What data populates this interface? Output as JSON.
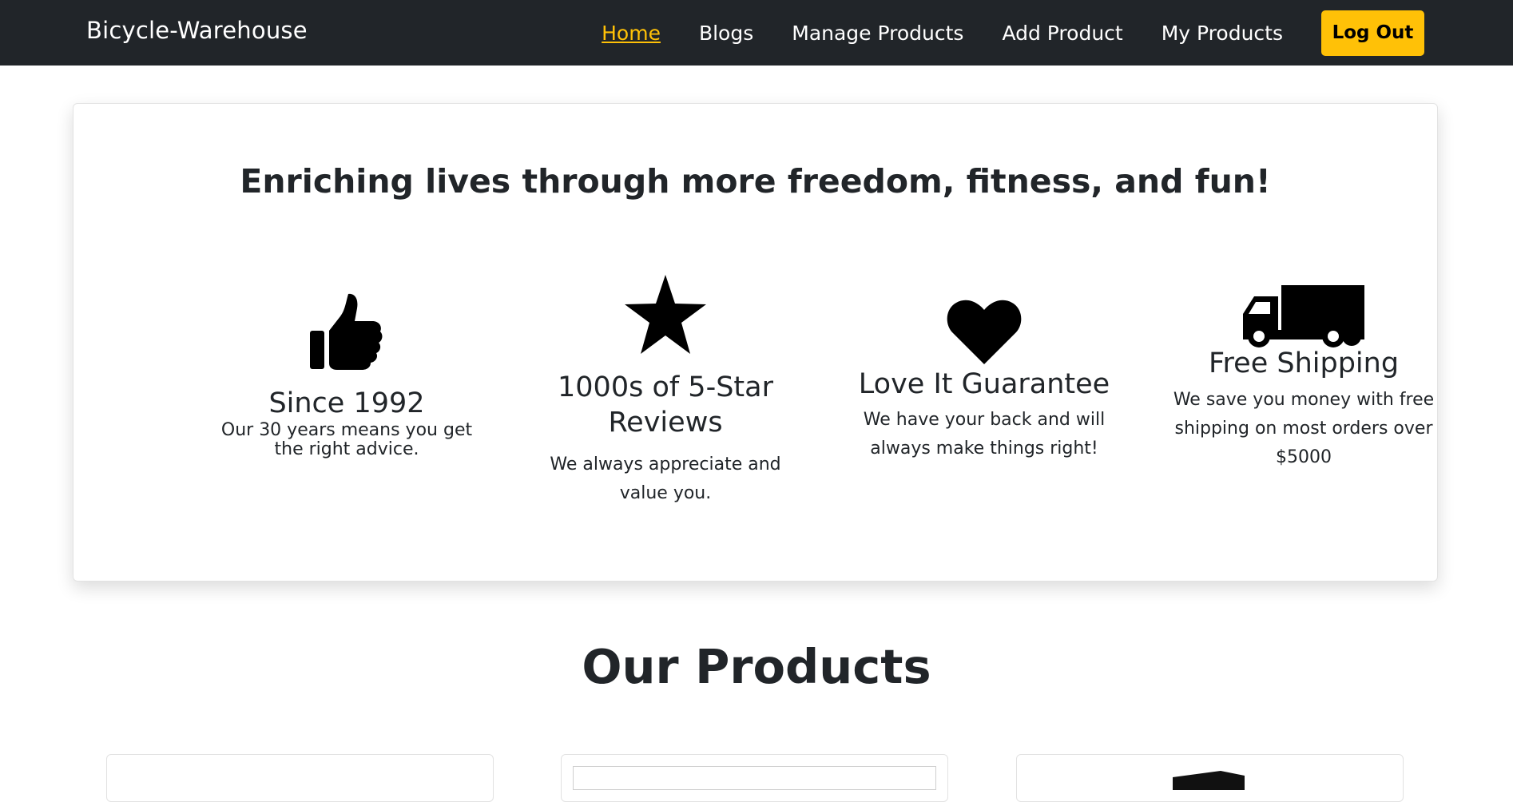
{
  "navbar": {
    "brand": "Bicycle-Warehouse",
    "links": [
      {
        "label": "Home",
        "active": true
      },
      {
        "label": "Blogs",
        "active": false
      },
      {
        "label": "Manage Products",
        "active": false
      },
      {
        "label": "Add Product",
        "active": false
      },
      {
        "label": "My Products",
        "active": false
      }
    ],
    "logout_label": "Log Out",
    "accent_color": "#ffc107",
    "background_color": "#212529"
  },
  "hero": {
    "title": "Enriching lives through more freedom, fitness, and fun!",
    "features": [
      {
        "icon": "thumbs-up-icon",
        "title": "Since 1992",
        "text": "Our 30 years means you get the right advice."
      },
      {
        "icon": "star-icon",
        "title": "1000s of 5-Star Reviews",
        "text": "We always appreciate and value you."
      },
      {
        "icon": "heart-icon",
        "title": "Love It Guarantee",
        "text": "We have your back and will always make things right!"
      },
      {
        "icon": "truck-icon",
        "title": "Free Shipping",
        "text": "We save you money with free shipping on most orders over $5000"
      }
    ]
  },
  "products_section": {
    "title": "Our Products"
  }
}
